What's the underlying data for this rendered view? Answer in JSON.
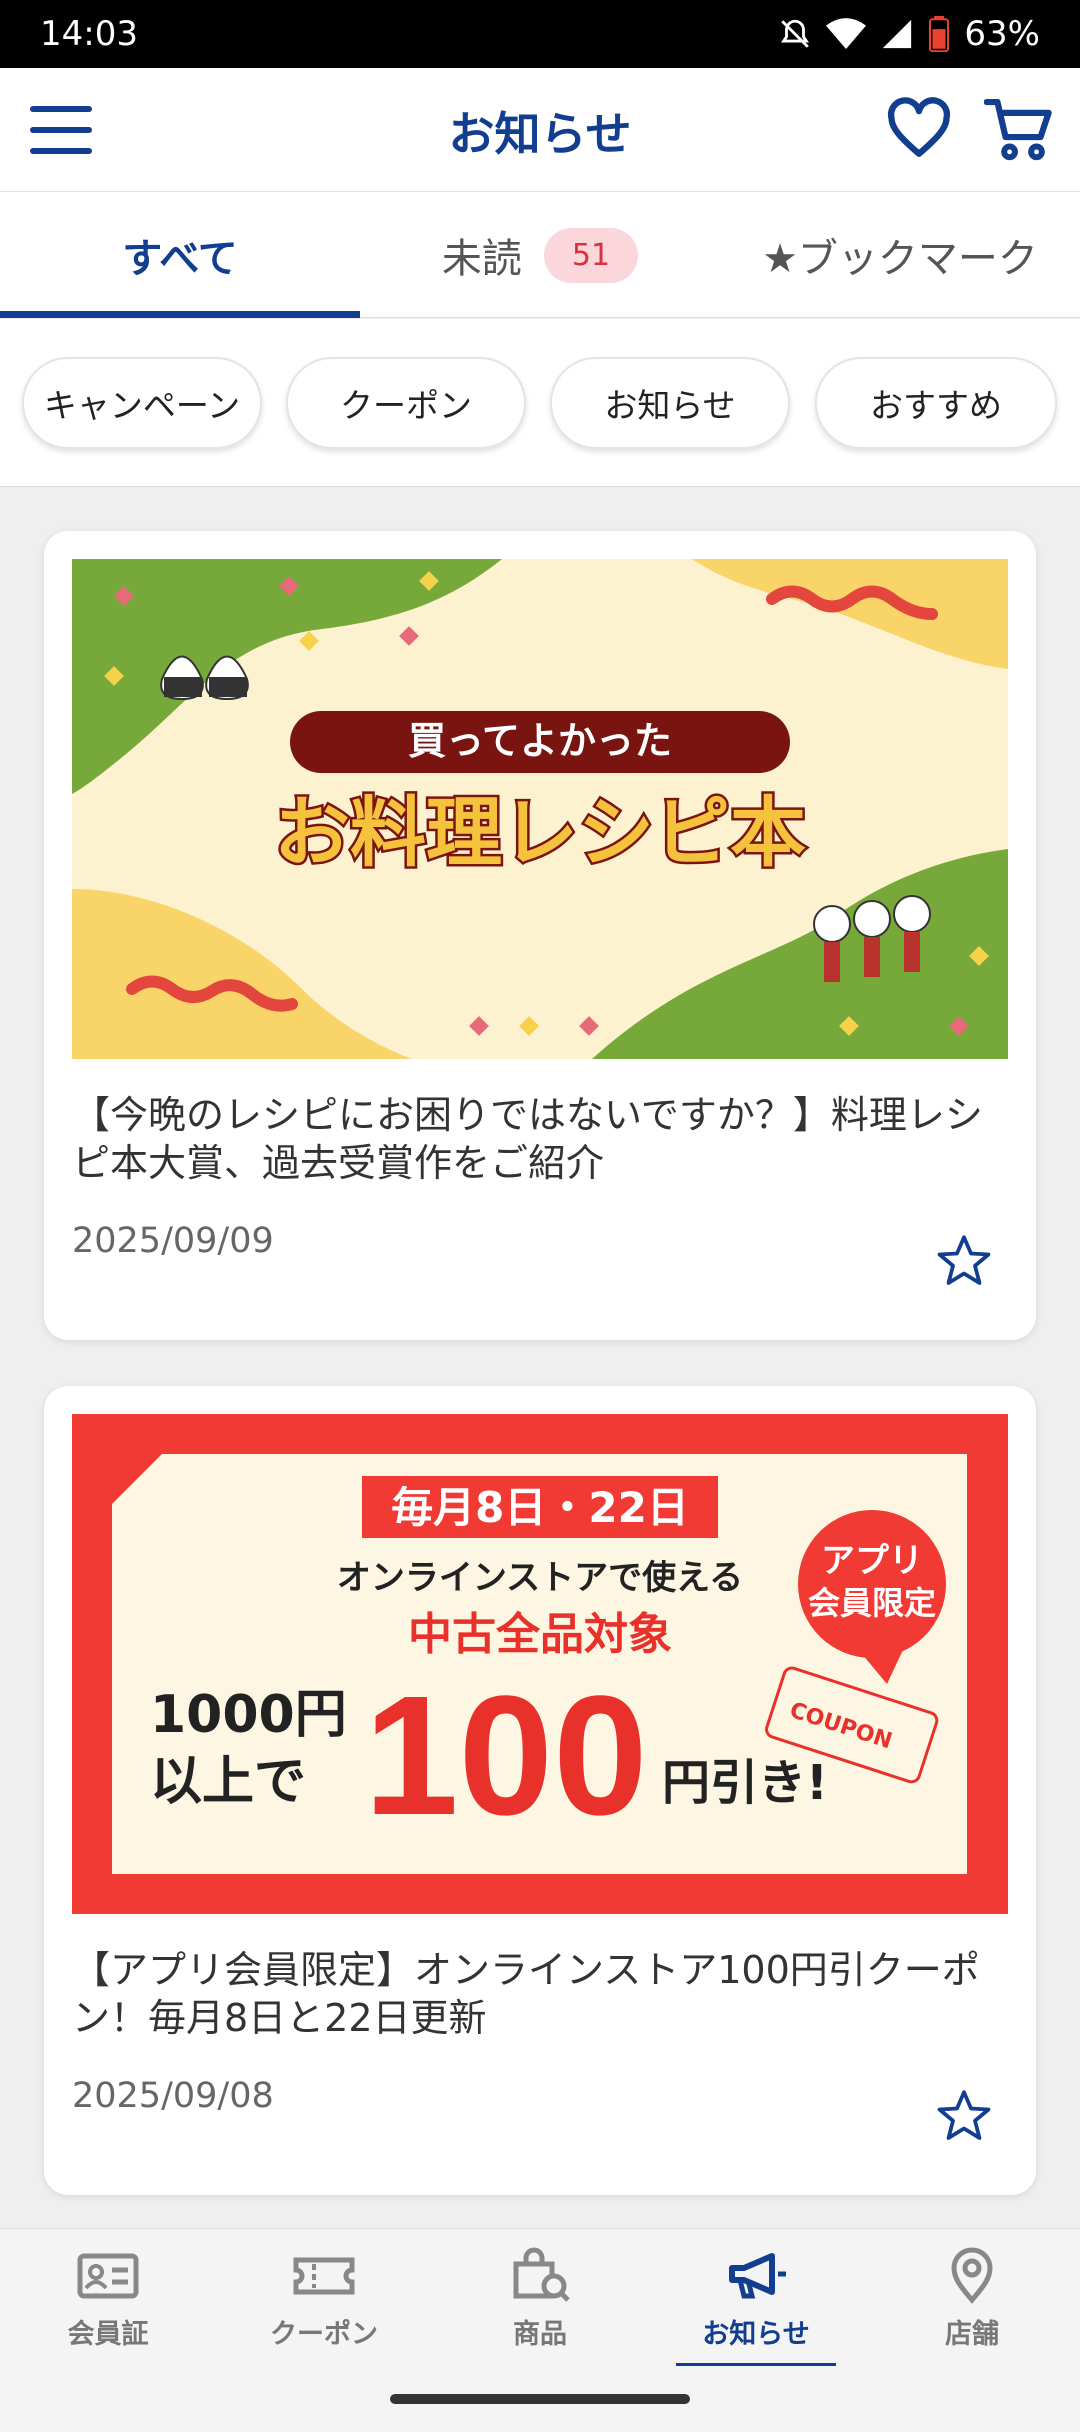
{
  "status_bar": {
    "time": "14:03",
    "battery": "63%"
  },
  "header": {
    "title": "お知らせ",
    "menu_icon": "hamburger-menu-icon",
    "favorite_icon": "heart-icon",
    "cart_icon": "cart-icon"
  },
  "tabs": [
    {
      "label": "すべて",
      "active": true
    },
    {
      "label": "未読",
      "badge": "51"
    },
    {
      "label": "★ブックマーク"
    }
  ],
  "chips": [
    "キャンペーン",
    "クーポン",
    "お知らせ",
    "おすすめ"
  ],
  "articles": [
    {
      "title": "【今晩のレシピにお困りではないですか？】料理レシピ本大賞、過去受賞作をご紹介",
      "date": "2025/09/09",
      "banner": {
        "ribbon": "買ってよかった",
        "headline": "お料理レシピ本"
      }
    },
    {
      "title": "【アプリ会員限定】オンラインストア100円引クーポン！毎月8日と22日更新",
      "date": "2025/09/08",
      "banner": {
        "top": "毎月8日・22日",
        "line1": "オンラインストアで使える",
        "line2": "中古全品対象",
        "left_a": "1000円",
        "left_b": "以上で",
        "big": "100",
        "right": "円引き!",
        "badge_a": "アプリ",
        "badge_b": "会員限定",
        "coupon": "COUPON"
      }
    }
  ],
  "bottom_nav": [
    {
      "label": "会員証",
      "icon": "member-card-icon"
    },
    {
      "label": "クーポン",
      "icon": "ticket-icon"
    },
    {
      "label": "商品",
      "icon": "shopping-bag-search-icon"
    },
    {
      "label": "お知らせ",
      "icon": "megaphone-icon",
      "active": true
    },
    {
      "label": "店舗",
      "icon": "location-pin-icon"
    }
  ],
  "colors": {
    "primary": "#123e8f",
    "badge_bg": "#fbd7db",
    "badge_text": "#d9303f",
    "coupon_red": "#f03a33"
  }
}
